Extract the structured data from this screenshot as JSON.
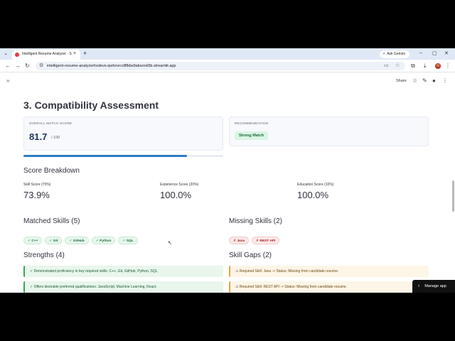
{
  "browser": {
    "tab_title": "Intelligent Resume Analyzer · Stre",
    "ask_gemini": "Ask Gemini",
    "url": "intelligent-resume-analyzerhxdevs-qwhnvrcsff8dw9absonk5b.streamlit.app",
    "profile_initial": "N"
  },
  "app_header": {
    "share_label": "Share"
  },
  "assessment": {
    "title": "3. Compatibility Assessment",
    "overall_label": "OVERALL MATCH SCORE",
    "overall_score": "81.7",
    "overall_max": "/ 100",
    "overall_fraction": 0.817,
    "recommendation_label": "RECOMMENDATION",
    "recommendation_value": "Strong Match"
  },
  "breakdown": {
    "title": "Score Breakdown",
    "metrics": [
      {
        "label": "Skill Score (70%)",
        "value": "73.9%"
      },
      {
        "label": "Experience Score (20%)",
        "value": "100.0%"
      },
      {
        "label": "Education Score (10%)",
        "value": "100.0%"
      }
    ]
  },
  "matched": {
    "title": "Matched Skills (5)",
    "skills": [
      "✓ C++",
      "✓ Git",
      "✓ GitHub",
      "✓ Python",
      "✓ SQL"
    ]
  },
  "missing": {
    "title": "Missing Skills (2)",
    "skills": [
      "✗ Java",
      "✗ REST API"
    ]
  },
  "strengths": {
    "title": "Strengths (4)",
    "items": [
      "✓ Demonstrated proficiency in key required skills: C++, Git, GitHub, Python, SQL.",
      "✓ Offers desirable preferred qualifications: JavaScript, Machine Learning, React."
    ]
  },
  "gaps": {
    "title": "Skill Gaps (2)",
    "items": [
      "⚠ Required Skill: Java -> Status: Missing from candidate resume.",
      "⚠ Required Skill: REST API -> Status: Missing from candidate resume."
    ]
  },
  "manage_app_label": "Manage app",
  "colors": {
    "accent": "#2f78c4",
    "success": "#3aa65b",
    "warning": "#e3a53a",
    "danger": "#a32020"
  }
}
